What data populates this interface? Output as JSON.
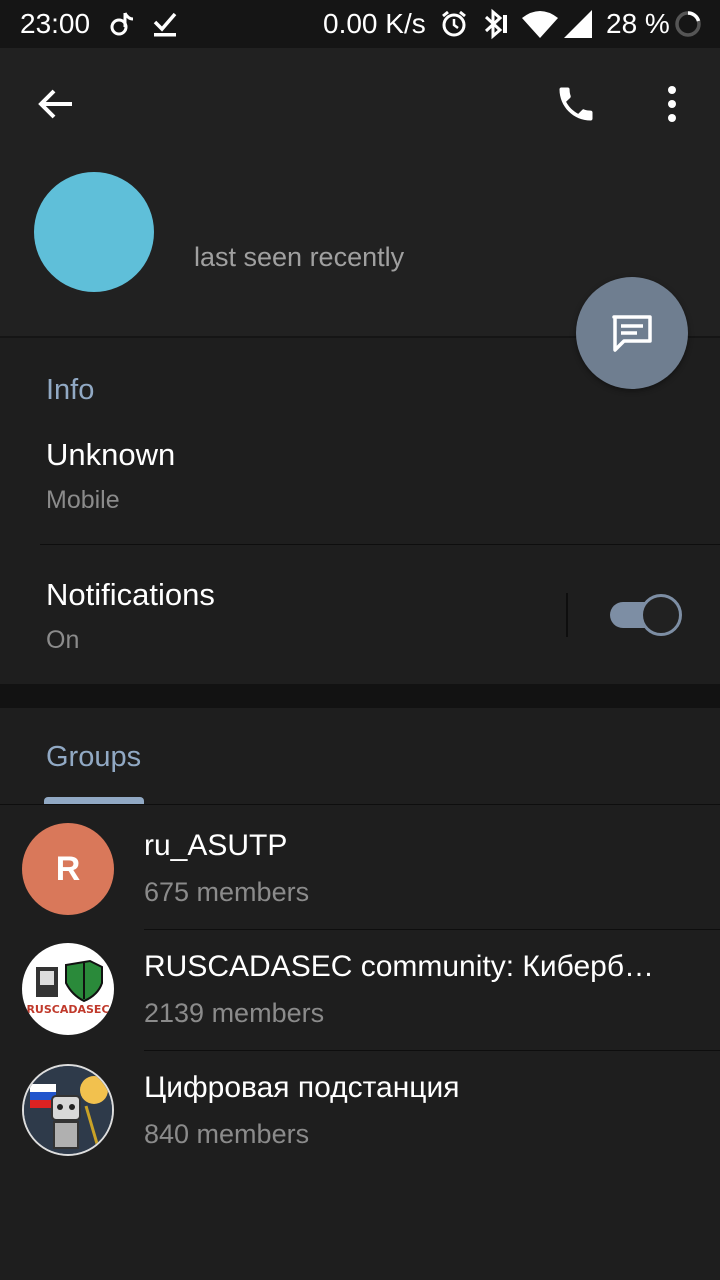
{
  "status_bar": {
    "time": "23:00",
    "net_speed": "0.00 K/s",
    "battery": "28 %",
    "icons": [
      "tiktok-icon",
      "download-done-icon",
      "alarm-icon",
      "bluetooth-icon",
      "wifi-icon",
      "signal-icon",
      "battery-ring-icon"
    ]
  },
  "header": {
    "back_icon": "arrow-left-icon",
    "call_icon": "phone-icon",
    "menu_icon": "more-vert-icon",
    "status": "last seen recently",
    "avatar_color": "#5fbfd9",
    "fab_icon": "message-icon",
    "fab_color": "#6f7e90"
  },
  "info": {
    "title": "Info",
    "phone_value": "Unknown",
    "phone_label": "Mobile",
    "notifications_label": "Notifications",
    "notifications_value": "On",
    "notifications_enabled": true
  },
  "groups": {
    "tab_label": "Groups",
    "items": [
      {
        "title": "ru_ASUTP",
        "subtitle": "675 members",
        "avatar_letter": "R",
        "avatar_color": "#d9785a"
      },
      {
        "title": "RUSCADASEC community: Киберб…",
        "subtitle": "2139 members",
        "avatar_text": "RUSCADASEC"
      },
      {
        "title": "Цифровая подстанция",
        "subtitle": "840 members"
      }
    ]
  },
  "colors": {
    "accent": "#91a9c4",
    "background": "#1e1e1e"
  }
}
